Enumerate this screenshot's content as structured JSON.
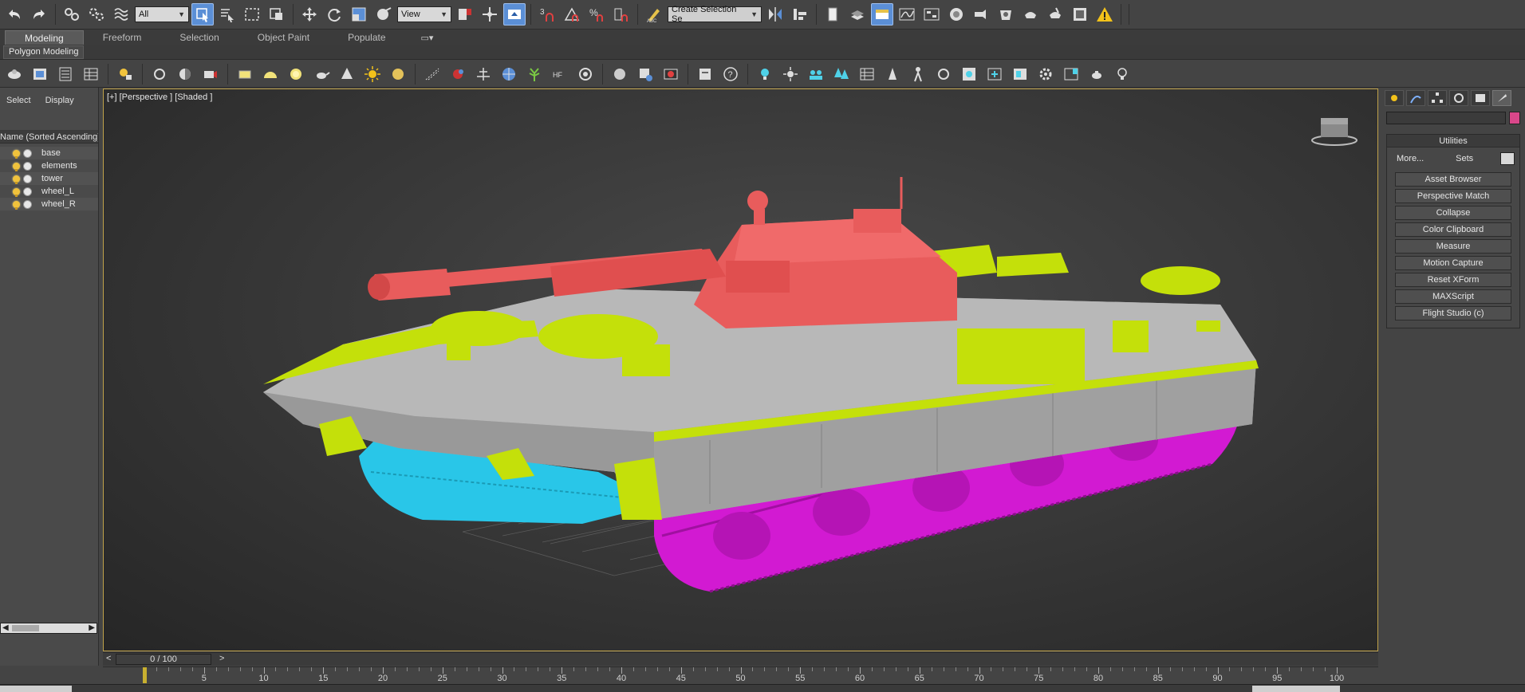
{
  "toolbar": {
    "selection_filter": "All",
    "ref_coord": "View",
    "named_selection": "Create Selection Se"
  },
  "ribbon": {
    "tabs": [
      "Modeling",
      "Freeform",
      "Selection",
      "Object Paint",
      "Populate"
    ],
    "active_tab": "Modeling",
    "panel_label": "Polygon Modeling"
  },
  "explorer": {
    "tabs": [
      "Select",
      "Display"
    ],
    "column_header": "Name (Sorted Ascending)",
    "items": [
      "base",
      "elements",
      "tower",
      "wheel_L",
      "wheel_R"
    ]
  },
  "viewport": {
    "label": "[+] [Perspective ] [Shaded ]"
  },
  "command_panel": {
    "rollout_title": "Utilities",
    "more_label": "More...",
    "sets_label": "Sets",
    "utilities": [
      "Asset Browser",
      "Perspective Match",
      "Collapse",
      "Color Clipboard",
      "Measure",
      "Motion Capture",
      "Reset XForm",
      "MAXScript",
      "Flight Studio (c)"
    ],
    "swatch_color": "#d9478a"
  },
  "timeline": {
    "frame_display": "0 / 100",
    "prev": "<",
    "next": ">",
    "ruler_labels": [
      "5",
      "10",
      "15",
      "20",
      "25",
      "30",
      "35",
      "40",
      "45",
      "50",
      "55",
      "60",
      "65",
      "70",
      "75",
      "80",
      "85",
      "90",
      "95",
      "100"
    ]
  },
  "colors": {
    "turret": "#e85c5c",
    "details": "#c4e00a",
    "hull": "#a9a9a9",
    "wheel_L": "#29c6e8",
    "wheel_R": "#d21ad2",
    "viewport_border": "#c0a24a"
  }
}
